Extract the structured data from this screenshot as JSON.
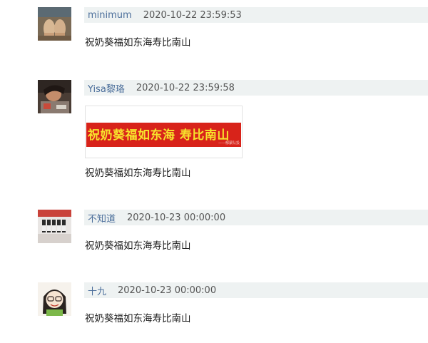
{
  "comments": [
    {
      "username": "minimum",
      "timestamp": "2020-10-22 23:59:53",
      "text": "祝奶葵福如东海寿比南山"
    },
    {
      "username": "Yisa黎珞",
      "timestamp": "2020-10-22 23:59:58",
      "image": {
        "banner_text": "祝奶葵福如东海 寿比南山",
        "banner_sub": "——郁蒙队投"
      },
      "text": "祝奶葵福如东海寿比南山"
    },
    {
      "username": "不知道",
      "timestamp": "2020-10-23 00:00:00",
      "text": "祝奶葵福如东海寿比南山"
    },
    {
      "username": "十九",
      "timestamp": "2020-10-23 00:00:00",
      "text": "祝奶葵福如东海寿比南山"
    }
  ],
  "colors": {
    "meta_bar_bg": "#eef2f2",
    "username": "#4a6d9a",
    "banner_red": "#d8231a",
    "banner_yellow": "#f7e22c"
  }
}
